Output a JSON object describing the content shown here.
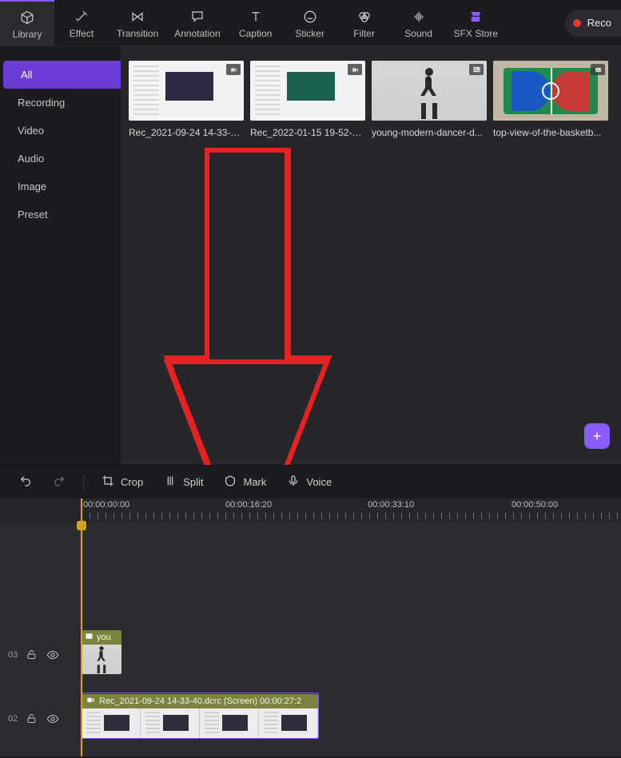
{
  "topTabs": [
    {
      "label": "Library"
    },
    {
      "label": "Effect"
    },
    {
      "label": "Transition"
    },
    {
      "label": "Annotation"
    },
    {
      "label": "Caption"
    },
    {
      "label": "Sticker"
    },
    {
      "label": "Filter"
    },
    {
      "label": "Sound"
    },
    {
      "label": "SFX Store"
    }
  ],
  "recordLabel": "Reco",
  "sidebar": {
    "items": [
      {
        "label": "All"
      },
      {
        "label": "Recording"
      },
      {
        "label": "Video"
      },
      {
        "label": "Audio"
      },
      {
        "label": "Image"
      },
      {
        "label": "Preset"
      }
    ]
  },
  "media": [
    {
      "name": "Rec_2021-09-24 14-33-40...."
    },
    {
      "name": "Rec_2022-01-15 19-52-12...."
    },
    {
      "name": "young-modern-dancer-d..."
    },
    {
      "name": "top-view-of-the-basketb..."
    }
  ],
  "tlTools": {
    "crop": "Crop",
    "split": "Split",
    "mark": "Mark",
    "voice": "Voice"
  },
  "ruler": {
    "t0": "00:00:00:00",
    "t1": "00:00:16:20",
    "t2": "00:00:33:10",
    "t3": "00:00:50:00"
  },
  "tracks": {
    "row03": "03",
    "row02": "02"
  },
  "clips": {
    "c03_label": "you",
    "c02_label": "Rec_2021-09-24 14-33-40.dcrc (Screen)  00:00:27:2"
  }
}
